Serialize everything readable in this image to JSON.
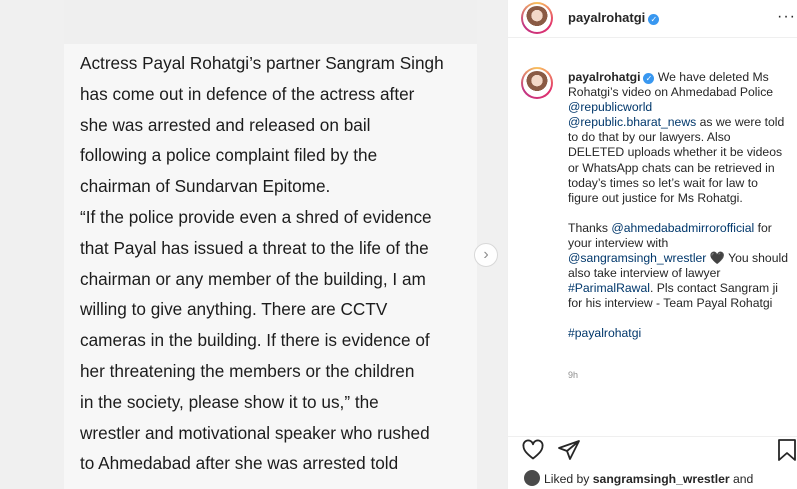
{
  "post": {
    "article_text": "Actress Payal Rohatgi’s partner Sangram Singh\nhas come out in defence of the actress after\nshe was arrested and released on bail\nfollowing a police complaint filed by the\nchairman of Sundarvan Epitome.\n“If the police provide even a shred of evidence\nthat Payal has issued a threat to the life of the\nchairman or any member of the building, I am\nwilling to give anything. There are CCTV\ncameras in the building. If there is evidence of\nher threatening the members or the children\nin the society, please show it to us,” the\nwrestler and motivational speaker who rushed\nto Ahmedabad after she was arrested told",
    "next_arrow": "›"
  },
  "header": {
    "username": "payalrohatgi",
    "verified_glyph": "✓",
    "more_glyph": "···"
  },
  "caption": {
    "username": "payalrohatgi",
    "verified_glyph": "✓",
    "para1_a": " We have deleted Ms Rohatgi’s video on Ahmedabad Police ",
    "mention1": "@republicworld",
    "mention2": "@republic.bharat_news",
    "para1_b": " as we were told to do that by our lawyers. Also DELETED uploads whether it be videos or WhatsApp chats can be retrieved in today’s times so let’s wait for law to figure out justice for Ms Rohatgi.",
    "para2_a": "Thanks ",
    "mention3": "@ahmedabadmirrorofficial",
    "para2_b": " for your interview with ",
    "mention4": "@sangramsingh_wrestler",
    "para2_c": " 🖤 You should also take interview of lawyer ",
    "hashtag1": "#ParimalRawal",
    "para2_d": ". Pls contact Sangram ji for his interview - Team Payal Rohatgi",
    "hashtag2": "#payalrohatgi",
    "time": "9h"
  },
  "likes": {
    "prefix": "Liked by ",
    "user": "sangramsingh_wrestler",
    "suffix": " and"
  },
  "icons": {
    "heart": "heart-icon",
    "send": "send-icon",
    "bookmark": "bookmark-icon",
    "more": "more-options-icon"
  }
}
